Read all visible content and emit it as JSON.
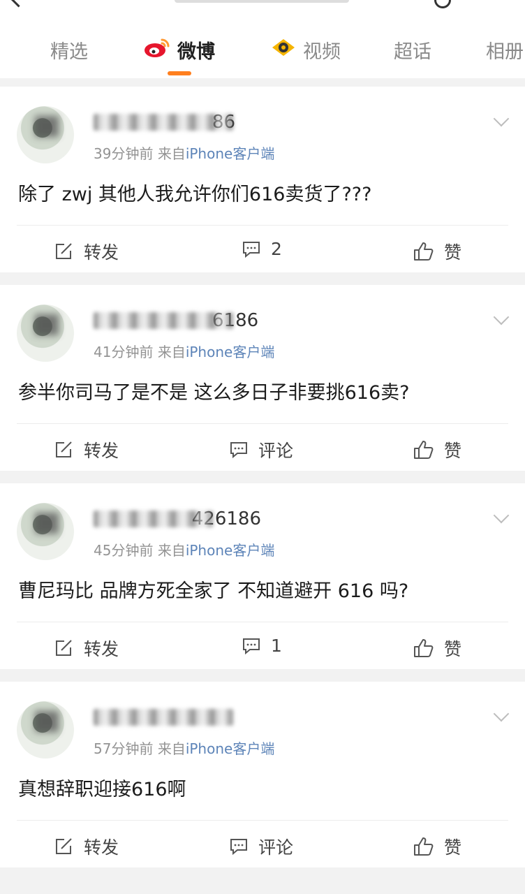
{
  "tabs": [
    {
      "label": "精选",
      "icon": ""
    },
    {
      "label": "微博",
      "icon": "weibo-logo-icon",
      "active": true
    },
    {
      "label": "视频",
      "icon": "video-eye-icon"
    },
    {
      "label": "超话",
      "icon": ""
    },
    {
      "label": "相册",
      "icon": ""
    }
  ],
  "colors": {
    "accent": "#ff7f1e",
    "link": "#5d84b8",
    "meta": "#939393"
  },
  "posts": [
    {
      "name_suffix": "86",
      "time": "39分钟前",
      "from": "来自",
      "source": "iPhone客户端",
      "content": "除了 zwj 其他人我允许你们616卖货了???",
      "repost": "转发",
      "comment": "2",
      "like": "赞"
    },
    {
      "name_suffix": "6186",
      "time": "41分钟前",
      "from": "来自",
      "source": "iPhone客户端",
      "content": "参半你司马了是不是 这么多日子非要挑616卖?",
      "repost": "转发",
      "comment": "评论",
      "like": "赞"
    },
    {
      "name_suffix": "426186",
      "time": "45分钟前",
      "from": "来自",
      "source": "iPhone客户端",
      "content": "曹尼玛比 品牌方死全家了 不知道避开 616 吗?",
      "repost": "转发",
      "comment": "1",
      "like": "赞"
    },
    {
      "name_suffix": "",
      "time": "57分钟前",
      "from": "来自",
      "source": "iPhone客户端",
      "content": "真想辞职迎接616啊",
      "repost": "转发",
      "comment": "评论",
      "like": "赞"
    }
  ]
}
